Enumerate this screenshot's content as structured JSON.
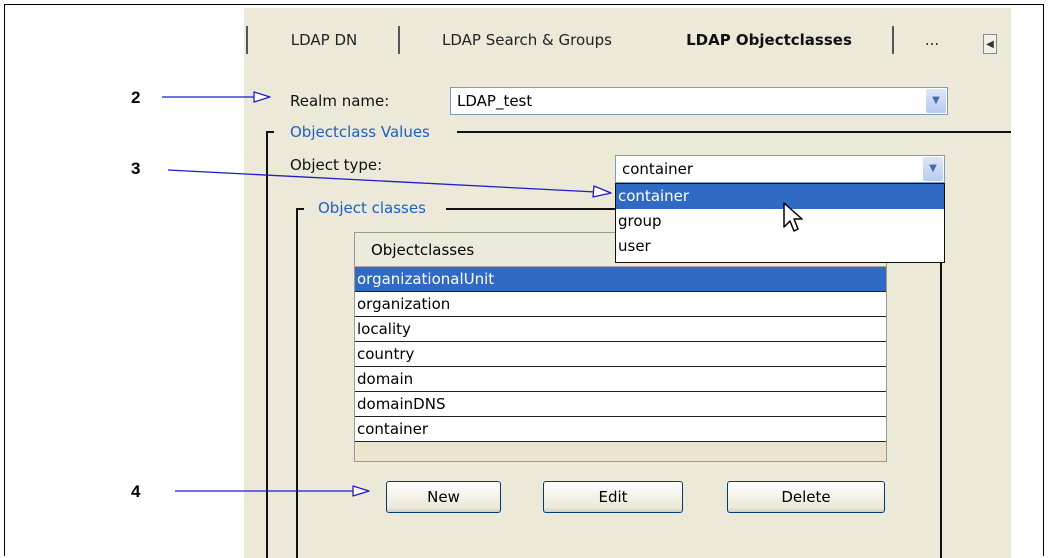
{
  "callouts": [
    "2",
    "3",
    "4"
  ],
  "tabs": [
    "LDAP DN",
    "LDAP Search & Groups",
    "LDAP Objectclasses",
    "..."
  ],
  "realm": {
    "label": "Realm name:",
    "value": "LDAP_test"
  },
  "objectclass_values_group": "Objectclass Values",
  "object_type": {
    "label": "Object type:",
    "value": "container",
    "options": [
      "container",
      "group",
      "user"
    ],
    "highlighted": "container"
  },
  "object_classes_group": "Object classes",
  "objectclasses_table": {
    "header": "Objectclasses",
    "rows": [
      "organizationalUnit",
      "organization",
      "locality",
      "country",
      "domain",
      "domainDNS",
      "container"
    ],
    "selected": "organizationalUnit"
  },
  "buttons": {
    "new": "New",
    "edit": "Edit",
    "delete": "Delete"
  },
  "colors": {
    "accent": "#316ac5",
    "group_label": "#1a5fc7",
    "arrow": "#1c1cc8",
    "dialog_bg": "#ece9d8"
  }
}
